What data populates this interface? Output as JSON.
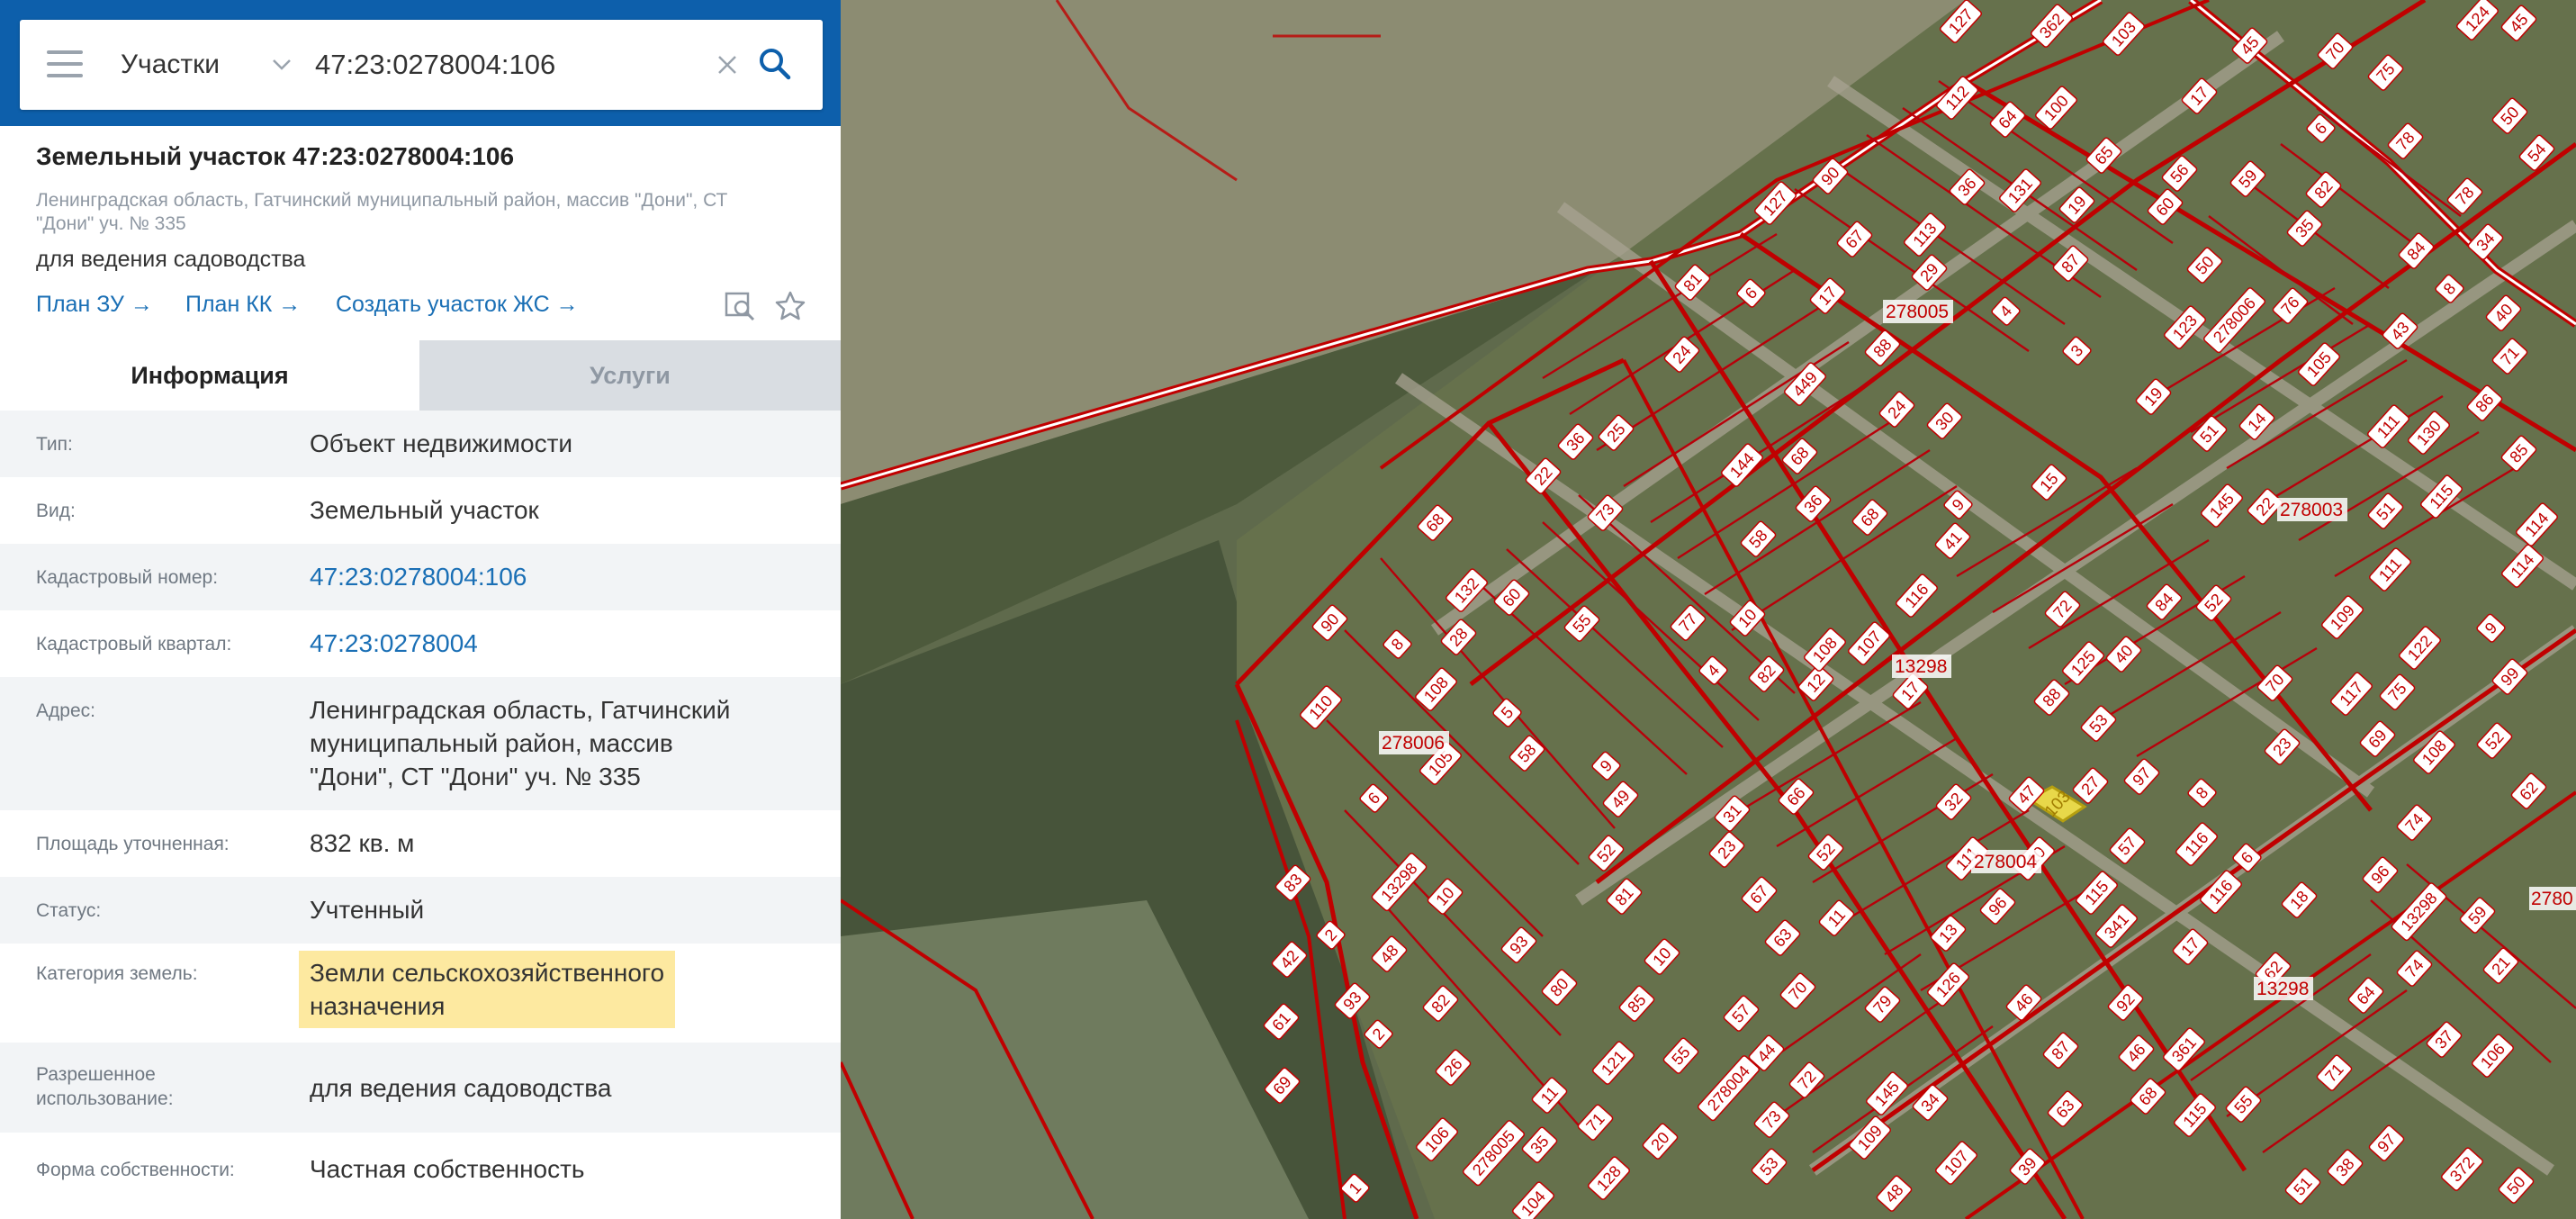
{
  "search": {
    "type_label": "Участки",
    "query": "47:23:0278004:106"
  },
  "object": {
    "title": "Земельный участок 47:23:0278004:106",
    "address_line1": "Ленинградская область, Гатчинский муниципальный район, массив \"Дони\", СТ",
    "address_line2": "\"Дони\" уч. № 335",
    "purpose": "для ведения садоводства",
    "links": [
      "План ЗУ →",
      "План КК →",
      "Создать участок ЖС →"
    ]
  },
  "tabs": [
    "Информация",
    "Услуги"
  ],
  "info_rows": [
    {
      "label": "Тип:",
      "value": "Объект недвижимости"
    },
    {
      "label": "Вид:",
      "value": "Земельный участок"
    },
    {
      "label": "Кадастровый номер:",
      "value": "47:23:0278004:106"
    },
    {
      "label": "Кадастровый квартал:",
      "value": "47:23:0278004"
    },
    {
      "label": "Адрес:",
      "value_lines": [
        "Ленинградская область, Гатчинский",
        "муниципальный район, массив",
        "\"Дони\", СТ \"Дони\" уч. № 335"
      ]
    },
    {
      "label": "Площадь уточненная:",
      "value": "832 кв. м"
    },
    {
      "label": "Статус:",
      "value": "Учтенный"
    },
    {
      "label": "Категория земель:",
      "value_lines": [
        "Земли сельскохозяйственного",
        "назначения"
      ]
    },
    {
      "label_lines": [
        "Разрешенное",
        "использование:"
      ],
      "value": "для ведения садоводства"
    },
    {
      "label": "Форма собственности:",
      "value": "Частная собственность"
    }
  ],
  "map": {
    "quarter_labels": [
      "278005",
      "278003",
      "278006",
      "278004",
      "13298",
      "13298",
      "2780"
    ],
    "selected_parcel": "103",
    "parcel_numbers": [
      "12",
      "10",
      "9",
      "93",
      "100",
      "17",
      "19",
      "116",
      "372",
      "34",
      "4",
      "3",
      "1",
      "6",
      "24",
      "2",
      "25",
      "26",
      "8",
      "27",
      "86",
      "57",
      "58",
      "56",
      "38",
      "37",
      "36",
      "115",
      "278005",
      "41",
      "44",
      "42",
      "43",
      "57",
      "87",
      "82",
      "79",
      "82",
      "60",
      "59",
      "64",
      "67",
      "71",
      "97",
      "144",
      "145",
      "68",
      "69",
      "72",
      "74",
      "53",
      "51",
      "52",
      "55",
      "48",
      "46",
      "99",
      "15",
      "17",
      "96",
      "8",
      "9",
      "6",
      "10",
      "11",
      "35",
      "73",
      "75",
      "77",
      "82",
      "78",
      "81",
      "83",
      "70",
      "88",
      "84",
      "105",
      "97",
      "20",
      "22",
      "107",
      "108",
      "6",
      "5",
      "52",
      "17",
      "18",
      "107",
      "115",
      "111",
      "128",
      "23",
      "127",
      "449",
      "28",
      "29",
      "32",
      "31",
      "106",
      "34",
      "35",
      "36",
      "108",
      "109",
      "80",
      "81",
      "278006",
      "13298",
      "17",
      "24",
      "19",
      "23",
      "21",
      "8",
      "22",
      "10",
      "9",
      "4",
      "6",
      "361",
      "362",
      "104",
      "108",
      "103",
      "11",
      "13",
      "14",
      "124",
      "51",
      "50",
      "52",
      "53",
      "54",
      "55",
      "131",
      "122",
      "132",
      "47",
      "48",
      "46",
      "49",
      "55",
      "45",
      "50",
      "63",
      "61",
      "62",
      "60",
      "278004",
      "51",
      "127",
      "106",
      "50",
      "39",
      "30",
      "117",
      "110",
      "116",
      "109",
      "113",
      "105",
      "40",
      "115",
      "36",
      "45",
      "59",
      "58",
      "52",
      "125",
      "130",
      "66",
      "67",
      "65",
      "64",
      "68",
      "69",
      "70",
      "71",
      "73",
      "90",
      "75",
      "87",
      "85",
      "68",
      "114",
      "116",
      "121",
      "123",
      "110",
      "111",
      "126",
      "74",
      "76",
      "78",
      "70",
      "72",
      "114",
      "13298",
      "84",
      "85",
      "90",
      "93",
      "111",
      "112",
      "71",
      "2",
      "92",
      "40",
      "341",
      "68",
      "63",
      "145",
      "62",
      "96",
      "88"
    ]
  }
}
